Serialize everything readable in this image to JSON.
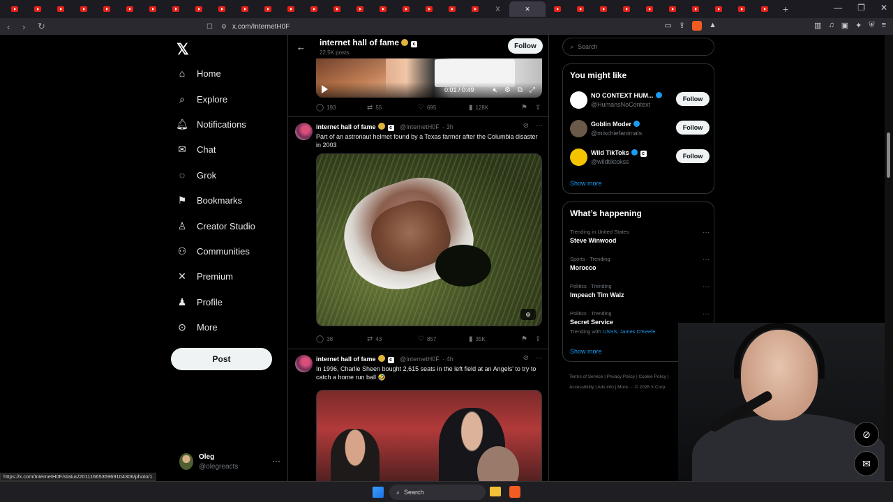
{
  "browser": {
    "tab_count_hint": "many",
    "active_tab_label": "X",
    "address": "x.com/InternetH0F",
    "status_url": "https://x.com/InternetH0F/status/2011166535969104306/photo/1"
  },
  "nav": {
    "items": [
      {
        "label": "Home",
        "icon": "home-icon"
      },
      {
        "label": "Explore",
        "icon": "search-icon"
      },
      {
        "label": "Notifications",
        "icon": "bell-icon"
      },
      {
        "label": "Chat",
        "icon": "mail-icon"
      },
      {
        "label": "Grok",
        "icon": "grok-icon"
      },
      {
        "label": "Bookmarks",
        "icon": "bookmark-icon"
      },
      {
        "label": "Creator Studio",
        "icon": "flask-icon"
      },
      {
        "label": "Communities",
        "icon": "people-icon"
      },
      {
        "label": "Premium",
        "icon": "x-icon"
      },
      {
        "label": "Profile",
        "icon": "person-icon"
      },
      {
        "label": "More",
        "icon": "more-circle-icon"
      }
    ],
    "post_label": "Post",
    "account": {
      "name": "Oleg",
      "handle": "@olegreacts"
    }
  },
  "header": {
    "title": "internet hall of fame",
    "posts": "22.5K posts",
    "follow_label": "Follow"
  },
  "video": {
    "time": "0:01 / 0:49"
  },
  "post0_stats": {
    "replies": "193",
    "reposts": "55",
    "likes": "695",
    "views": "128K"
  },
  "posts": [
    {
      "name": "internet hall of fame",
      "handle": "@InternetH0F",
      "age": "· 3h",
      "text": "Part of an astronaut helmet found by a Texas farmer after the Columbia disaster in 2003",
      "stats": {
        "replies": "38",
        "reposts": "43",
        "likes": "857",
        "views": "35K"
      }
    },
    {
      "name": "internet hall of fame",
      "handle": "@InternetH0F",
      "age": "· 4h",
      "text": "In 1996, Charlie Sheen bought 2,615 seats in the left field at an Angels' to try to catch a home run ball 🤣"
    }
  ],
  "right": {
    "search_placeholder": "Search",
    "you_might_like": "You might like",
    "suggestions": [
      {
        "name": "NO CONTEXT HUM...",
        "handle": "@HumansNoContext",
        "follow": "Follow",
        "color": "#ffffff"
      },
      {
        "name": "Goblin Moder",
        "handle": "@mischiefanimals",
        "follow": "Follow",
        "color": "#6b5a4a"
      },
      {
        "name": "Wild TikToks",
        "handle": "@wildtiktokss",
        "follow": "Follow",
        "color": "#f5c400"
      }
    ],
    "show_more": "Show more",
    "whats_happening": "What’s happening",
    "trends": [
      {
        "context": "Trending in United States",
        "title": "Steve Winwood"
      },
      {
        "context": "Sports · Trending",
        "title": "Morocco"
      },
      {
        "context": "Politics · Trending",
        "title": "Impeach Tim Walz"
      },
      {
        "context": "Politics · Trending",
        "title": "Secret Service",
        "with_label": "Trending with",
        "with": "USSS, James O'Keefe"
      }
    ],
    "show_more2": "Show more",
    "footer_line1": "Terms of Service  |  Privacy Policy  |  Cookie Policy  |",
    "footer_line2": "Accessibility  |  Ads info  |  More ···  © 2026 X Corp."
  },
  "taskbar": {
    "search": "Search"
  }
}
